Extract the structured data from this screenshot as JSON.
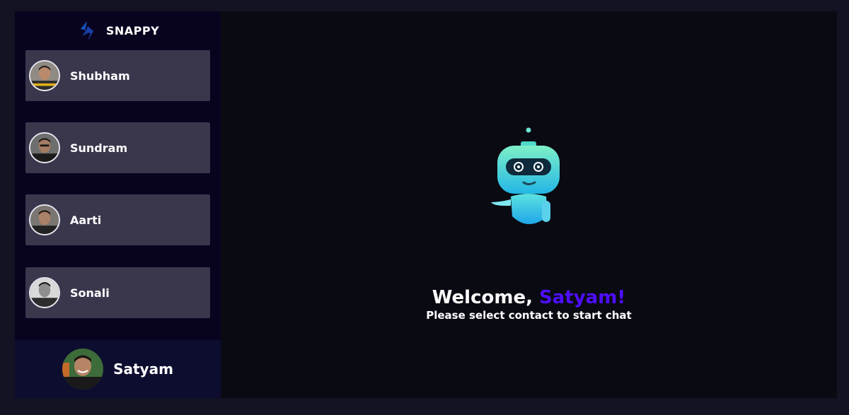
{
  "brand": {
    "name": "SNAPPY",
    "logo_icon": "snappy-logo-icon"
  },
  "contacts": [
    {
      "name": "Shubham",
      "avatar_icon": "avatar-icon"
    },
    {
      "name": "Sundram",
      "avatar_icon": "avatar-icon"
    },
    {
      "name": "Aarti",
      "avatar_icon": "avatar-icon"
    },
    {
      "name": "Sonali",
      "avatar_icon": "avatar-icon"
    }
  ],
  "current_user": {
    "name": "Satyam",
    "avatar_icon": "avatar-icon"
  },
  "welcome": {
    "prefix": "Welcome, ",
    "name": "Satyam!",
    "subtitle": "Please select contact to start chat",
    "illustration_icon": "robot-icon"
  },
  "colors": {
    "page_bg": "#131324",
    "sidebar_bg": "#080420",
    "contact_bg": "#ffffff34",
    "current_user_bg": "#0d0d30",
    "main_bg": "#0a0a13",
    "accent": "#4e0eff"
  }
}
